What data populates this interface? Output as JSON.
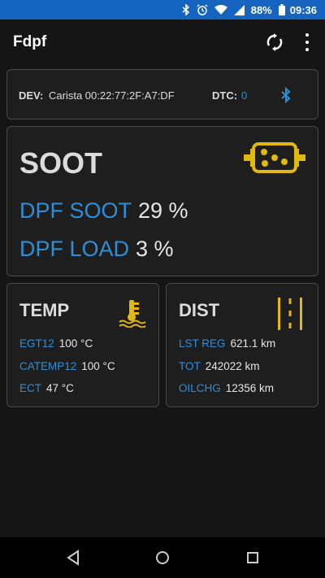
{
  "status_bar": {
    "battery": "88%",
    "time": "09:36",
    "icons": [
      "bluetooth-icon",
      "alarm-icon",
      "wifi-icon",
      "signal-icon",
      "battery-icon"
    ]
  },
  "app_bar": {
    "title": "Fdpf",
    "actions": [
      "sync-icon",
      "more-vert-icon"
    ]
  },
  "device": {
    "dev_label": "DEV:",
    "dev_value": "Carista 00:22:77:2F:A7:DF",
    "dtc_label": "DTC:",
    "dtc_value": "0",
    "bt_icon": "bluetooth-icon"
  },
  "soot": {
    "title": "SOOT",
    "icon": "dpf-filter-icon",
    "rows": [
      {
        "label": "DPF SOOT",
        "value": "29 %"
      },
      {
        "label": "DPF LOAD",
        "value": "3 %"
      }
    ]
  },
  "temp": {
    "title": "TEMP",
    "icon": "coolant-temp-icon",
    "rows": [
      {
        "label": "EGT12",
        "value": "100 °C"
      },
      {
        "label": "CATEMP12",
        "value": "100 °C"
      },
      {
        "label": "ECT",
        "value": "47 °C"
      }
    ]
  },
  "dist": {
    "title": "DIST",
    "icon": "road-icon",
    "rows": [
      {
        "label": "LST REG",
        "value": "621.1 km"
      },
      {
        "label": "TOT",
        "value": "242022 km"
      },
      {
        "label": "OILCHG",
        "value": "12356 km"
      }
    ]
  },
  "colors": {
    "accent_blue": "#2d8fd8",
    "icon_yellow": "#e2b80f",
    "status_bar": "#1565c0",
    "background": "#151515",
    "card": "#1e1e1e"
  },
  "nav_bar": [
    "back-icon",
    "home-icon",
    "recents-icon"
  ]
}
